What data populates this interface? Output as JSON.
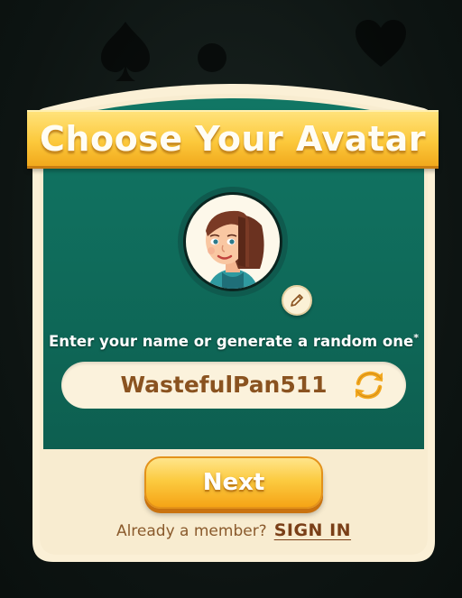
{
  "dialog": {
    "title": "Choose Your Avatar",
    "prompt": "Enter your name or generate a random one",
    "prompt_required_mark": "*"
  },
  "name_field": {
    "value": "WastefulPan511"
  },
  "icons": {
    "edit": "pencil-icon",
    "regenerate": "refresh-icon"
  },
  "next_button": {
    "label": "Next"
  },
  "footer": {
    "member_text": "Already a member?",
    "sign_in_label": "SIGN IN"
  },
  "colors": {
    "panel_green": "#0f6d5d",
    "banner_gold": "#fcc93c",
    "cream": "#fbf0d6",
    "name_text": "#8a5320",
    "button_orange": "#f5a416"
  }
}
